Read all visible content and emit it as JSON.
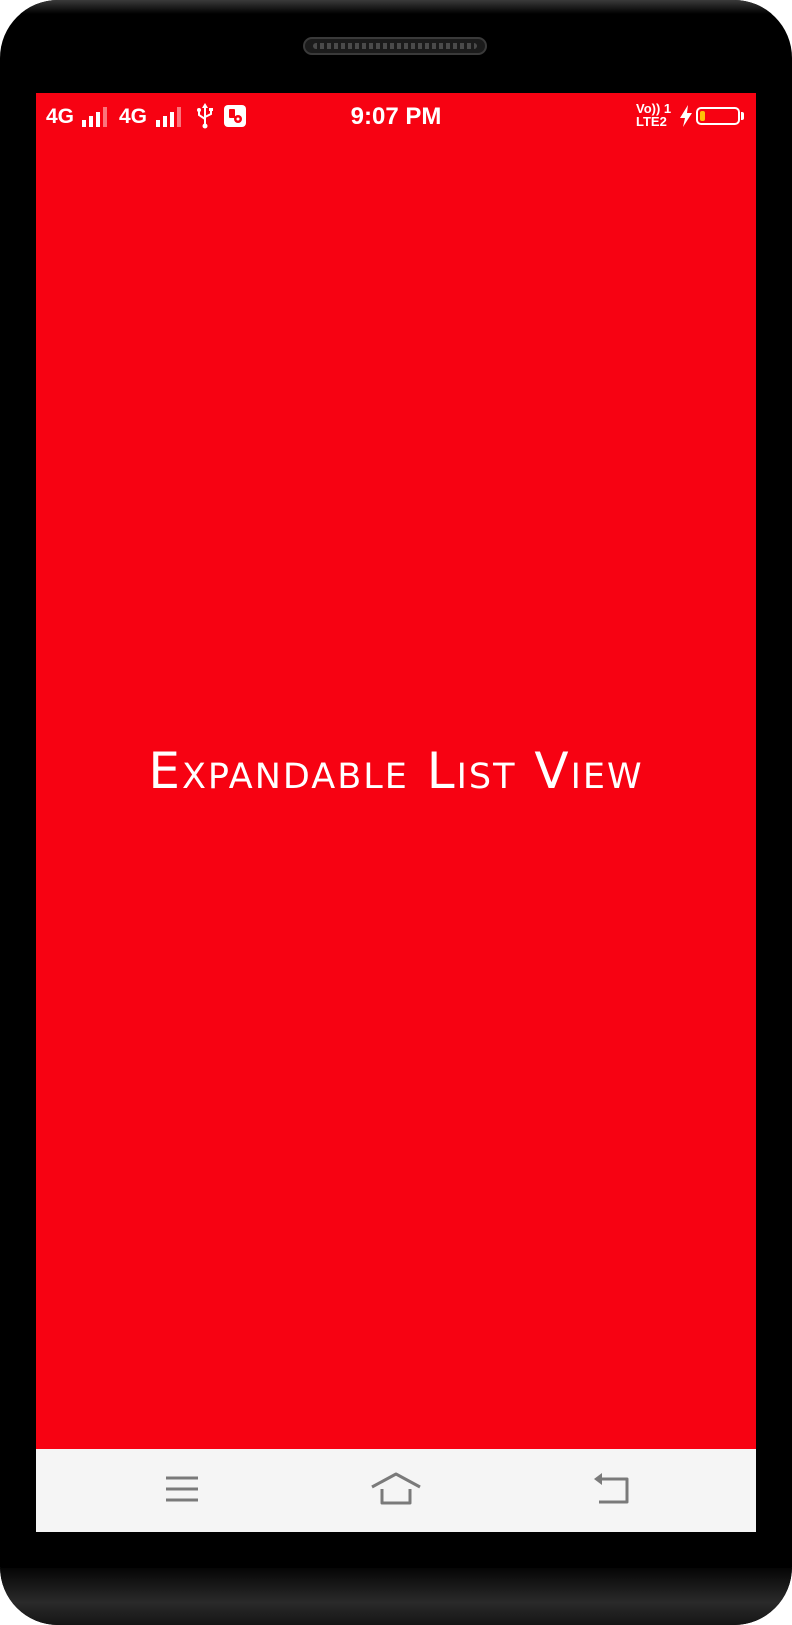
{
  "status_bar": {
    "network_1": "4G",
    "network_2": "4G",
    "time": "9:07 PM",
    "volte_line_1": "Vo)) 1",
    "volte_line_2": "LTE2",
    "battery_level": 0.15,
    "battery_fill_color": "#ffc107",
    "icons": [
      "signal-icon",
      "signal-icon",
      "usb-icon",
      "app-notification-icon",
      "volte-icon",
      "charging-bolt-icon",
      "battery-icon"
    ]
  },
  "main": {
    "title": "Expandable List View",
    "background_color": "#f70212",
    "text_color": "#ffffff"
  },
  "nav_bar": {
    "background_color": "#f5f5f5",
    "icon_color": "#7a7a7a",
    "buttons": [
      "menu-icon",
      "home-icon",
      "back-icon"
    ]
  }
}
